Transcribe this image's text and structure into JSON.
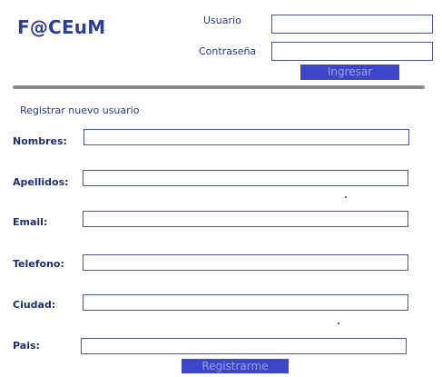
{
  "header": {
    "logo": "F@CEuM"
  },
  "login": {
    "username_label": "Usuario",
    "username_value": "",
    "password_label": "Contraseña",
    "password_value": "",
    "submit_label": "Ingresar"
  },
  "register": {
    "title": "Registrar nuevo usuario",
    "fields": {
      "nombres": {
        "label": "Nombres:",
        "value": ""
      },
      "apellidos": {
        "label": "Apellidos:",
        "value": ""
      },
      "email": {
        "label": "Email:",
        "value": ""
      },
      "telefono": {
        "label": "Telefono:",
        "value": ""
      },
      "ciudad": {
        "label": "Ciudad:",
        "value": ""
      },
      "pais": {
        "label": "Pais:",
        "value": ""
      }
    },
    "submit_label": "Registrarme"
  },
  "colors": {
    "brand": "#2f3f8f",
    "label_text": "#1f2f6e",
    "button_bg": "#3d46c9",
    "button_text": "#9aa0e6",
    "field_border": "#4b5598",
    "divider": "#8c8c8c"
  }
}
